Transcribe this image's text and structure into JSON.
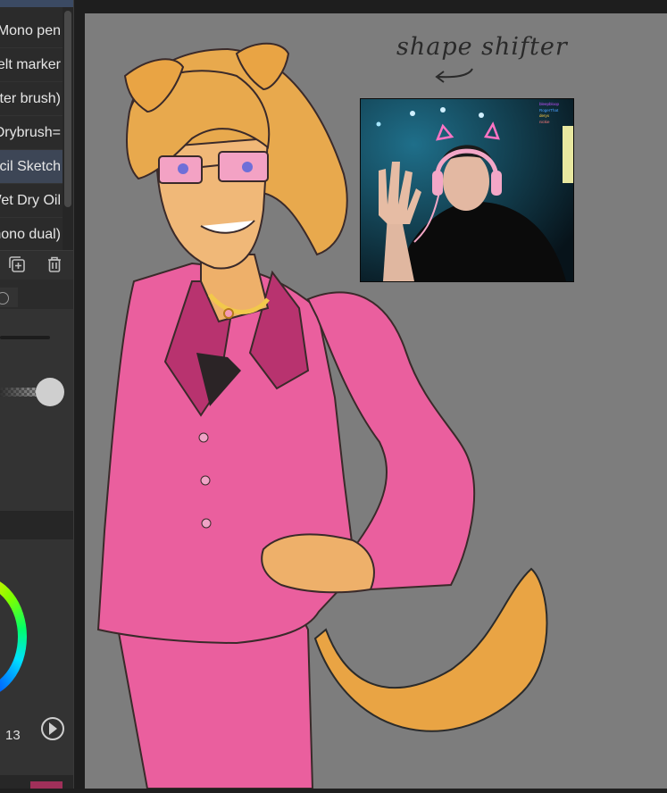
{
  "brush_panel": {
    "items": [
      {
        "label": "Mono pen",
        "selected": false
      },
      {
        "label": "Felt marker",
        "selected": false
      },
      {
        "label": "(Water brush)",
        "selected": false
      },
      {
        "label": "Drybrush=",
        "selected": false
      },
      {
        "label": "Pencil Sketch",
        "selected": true
      },
      {
        "label": "Wet Dry Oil",
        "selected": false
      },
      {
        "label": "(mono dual)",
        "selected": false
      }
    ]
  },
  "color_panel": {
    "zoom_value": "13"
  },
  "canvas": {
    "caption": "shape shifter",
    "background_color": "#7d7d7d"
  },
  "webcam": {
    "chat_lines": [
      {
        "text": "bleepbloop",
        "color": "#c050ff"
      },
      {
        "text": "RogerThat",
        "color": "#4aa0ff"
      },
      {
        "text": "deryx",
        "color": "#ffcc44"
      },
      {
        "text": "nickie",
        "color": "#ff7a7a"
      }
    ]
  },
  "colors": {
    "suit_pink": "#ea5f9e",
    "suit_shadow": "#b8336f",
    "hair": "#e8a94d",
    "selection": "#3d4656"
  }
}
